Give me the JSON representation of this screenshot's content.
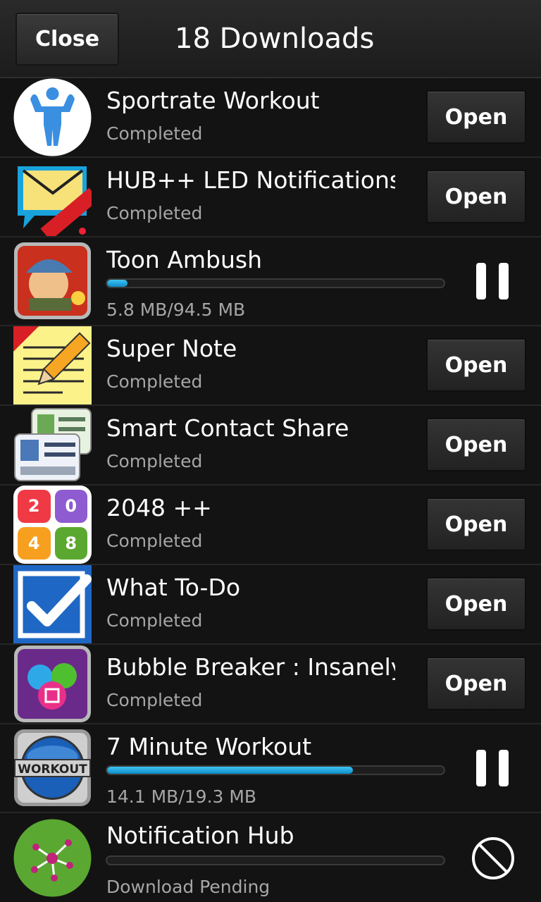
{
  "header": {
    "close_label": "Close",
    "title": "18 Downloads"
  },
  "colors": {
    "progress_fill": "#1aa7e0",
    "background": "#131313",
    "status_text": "#a6a6a6"
  },
  "items": [
    {
      "name": "Sportrate Workout",
      "status": "Completed",
      "action": "Open",
      "icon": "sportrate-workout-icon"
    },
    {
      "name": "HUB++ LED Notifications",
      "status": "Completed",
      "action": "Open",
      "icon": "hub-led-notifications-icon"
    },
    {
      "name": "Toon Ambush",
      "status": "5.8 MB/94.5 MB",
      "progress": 0.06,
      "icon": "toon-ambush-icon",
      "control": "pause-icon"
    },
    {
      "name": "Super Note",
      "status": "Completed",
      "action": "Open",
      "icon": "super-note-icon"
    },
    {
      "name": "Smart Contact Share",
      "status": "Completed",
      "action": "Open",
      "icon": "smart-contact-share-icon"
    },
    {
      "name": "2048 ++",
      "status": "Completed",
      "action": "Open",
      "icon": "2048-icon",
      "tiles": [
        "2",
        "0",
        "4",
        "8"
      ]
    },
    {
      "name": "What To-Do",
      "status": "Completed",
      "action": "Open",
      "icon": "what-todo-icon"
    },
    {
      "name": "Bubble Breaker : Insanely",
      "status": "Completed",
      "action": "Open",
      "icon": "bubble-breaker-icon"
    },
    {
      "name": "7 Minute Workout",
      "status": "14.1 MB/19.3 MB",
      "progress": 0.73,
      "icon": "7-minute-workout-icon",
      "icon_text": "WORKOUT",
      "control": "pause-icon"
    },
    {
      "name": "Notification Hub",
      "status": "Download Pending",
      "progress": 0,
      "icon": "notification-hub-icon",
      "control": "cancel-icon"
    }
  ]
}
